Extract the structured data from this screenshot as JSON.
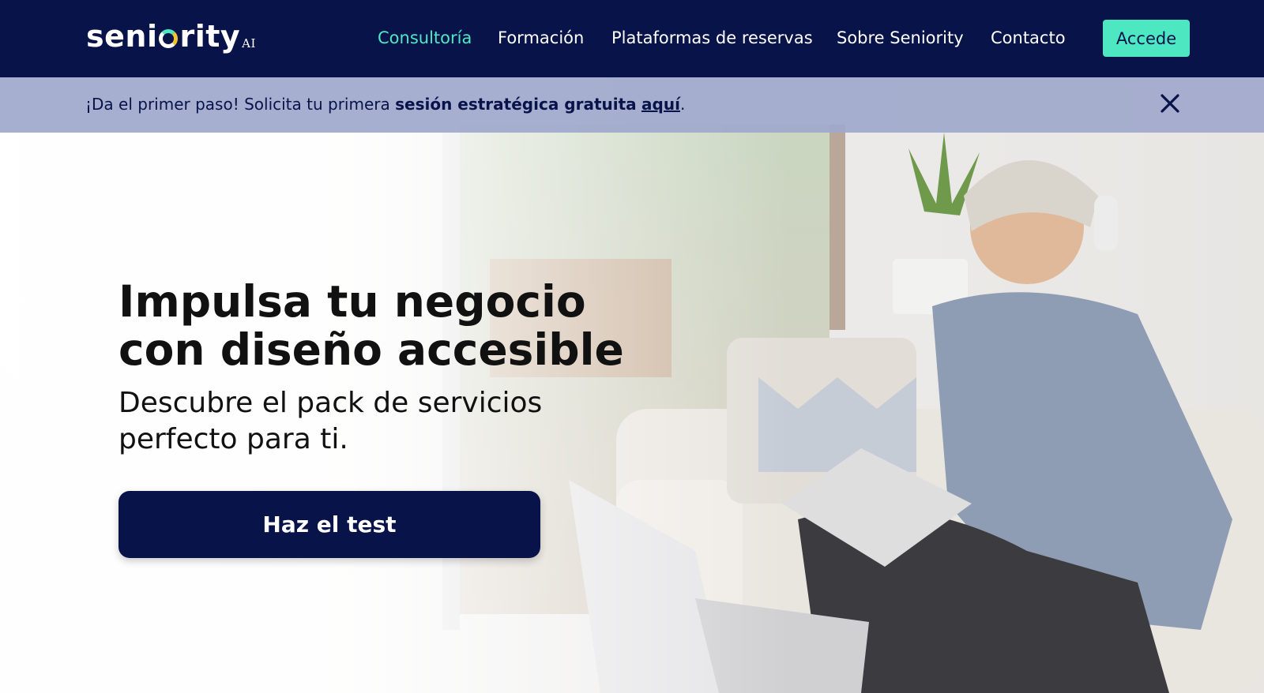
{
  "header": {
    "logo_text_before": "seni",
    "logo_text_after": "rity",
    "logo_suffix": "AI",
    "nav": [
      {
        "label": "Consultoría",
        "active": true
      },
      {
        "label": "Formación",
        "active": false
      },
      {
        "label": "Plataformas de reservas",
        "active": false
      },
      {
        "label": "Sobre Seniority",
        "active": false
      },
      {
        "label": "Contacto",
        "active": false
      }
    ],
    "login_label": "Accede"
  },
  "banner": {
    "text_prefix": "¡Da el primer paso! Solicita tu primera ",
    "text_bold": "sesión estratégica gratuita",
    "text_space": " ",
    "link_label": "aquí",
    "text_suffix": ".",
    "close_icon": "close-icon"
  },
  "hero": {
    "headline_line1": "Impulsa tu negocio",
    "headline_line2": "con diseño accesible",
    "subline_line1": "Descubre el pack de servicios",
    "subline_line2": "perfecto para ti.",
    "cta_label": "Haz el test"
  },
  "colors": {
    "navy": "#08134a",
    "accent": "#4de8c2",
    "banner_bg": "#a0a8cc"
  }
}
